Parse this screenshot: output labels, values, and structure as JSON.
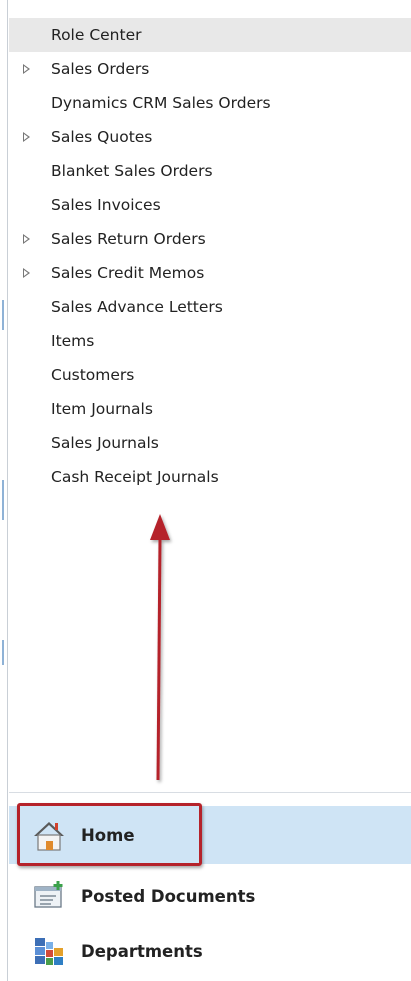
{
  "nav": {
    "items": [
      {
        "label": "Role Center",
        "expandable": false,
        "selected": true
      },
      {
        "label": "Sales Orders",
        "expandable": true,
        "selected": false
      },
      {
        "label": "Dynamics CRM Sales Orders",
        "expandable": false,
        "selected": false
      },
      {
        "label": "Sales Quotes",
        "expandable": true,
        "selected": false
      },
      {
        "label": "Blanket Sales Orders",
        "expandable": false,
        "selected": false
      },
      {
        "label": "Sales Invoices",
        "expandable": false,
        "selected": false
      },
      {
        "label": "Sales Return Orders",
        "expandable": true,
        "selected": false
      },
      {
        "label": "Sales Credit Memos",
        "expandable": true,
        "selected": false
      },
      {
        "label": "Sales Advance Letters",
        "expandable": false,
        "selected": false
      },
      {
        "label": "Items",
        "expandable": false,
        "selected": false
      },
      {
        "label": "Customers",
        "expandable": false,
        "selected": false
      },
      {
        "label": "Item Journals",
        "expandable": false,
        "selected": false
      },
      {
        "label": "Sales Journals",
        "expandable": false,
        "selected": false
      },
      {
        "label": "Cash Receipt Journals",
        "expandable": false,
        "selected": false
      }
    ]
  },
  "navigation_pane": {
    "home": {
      "label": "Home",
      "icon": "home-icon"
    },
    "posted_documents": {
      "label": "Posted Documents",
      "icon": "posted-documents-icon"
    },
    "departments": {
      "label": "Departments",
      "icon": "departments-icon"
    }
  },
  "colors": {
    "selected_row": "#e8e8e8",
    "active_button": "#cfe4f5",
    "annotation_red": "#b5222a"
  }
}
